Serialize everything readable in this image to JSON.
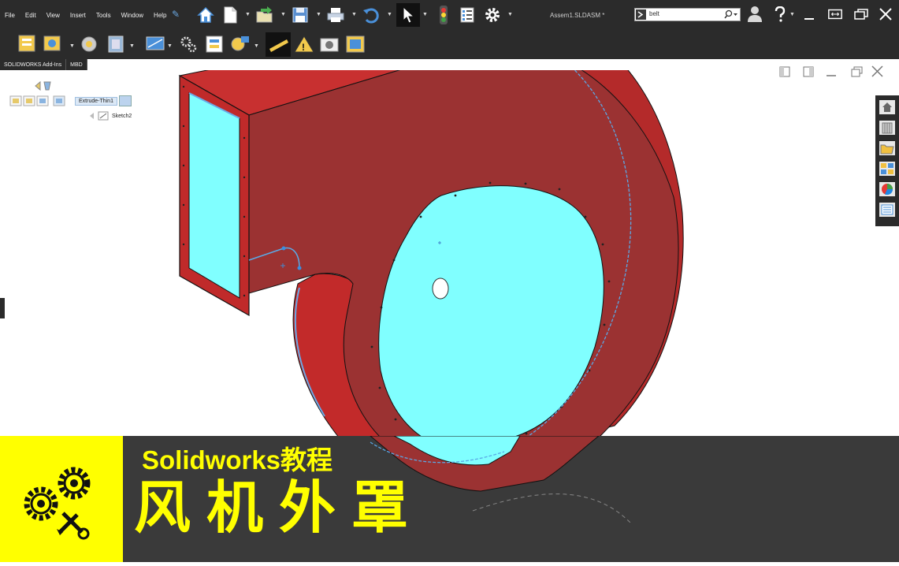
{
  "menu": {
    "items": [
      "File",
      "Edit",
      "View",
      "Insert",
      "Tools",
      "Window",
      "Help"
    ]
  },
  "document": {
    "title": "Assem1.SLDASM *"
  },
  "search": {
    "value": "belt"
  },
  "tabs": [
    {
      "label": "SOLIDWORKS Add-Ins"
    },
    {
      "label": "MBD"
    }
  ],
  "feature_tree": {
    "feature": "Extrude-Thin1",
    "sketch": "Sketch2"
  },
  "banner": {
    "subtitle": "Solidworks教程",
    "title": "风机外罩"
  },
  "icons": {
    "home": "home-icon",
    "new": "new-document-icon",
    "open": "open-icon",
    "save": "save-icon",
    "print": "print-icon",
    "undo": "undo-icon",
    "select": "select-cursor-icon",
    "rebuild": "traffic-light-icon",
    "file_properties": "file-properties-icon",
    "options": "gear-icon",
    "user": "user-icon",
    "help": "help-icon"
  },
  "colors": {
    "app_dark": "#2b2b2b",
    "housing_red": "#9b3232",
    "housing_edge": "#d72a2a",
    "face_cyan": "#80ffff",
    "banner_yellow": "#ffff00",
    "banner_dark": "#3a3a3a",
    "sketch_blue": "#5aa9e6"
  }
}
